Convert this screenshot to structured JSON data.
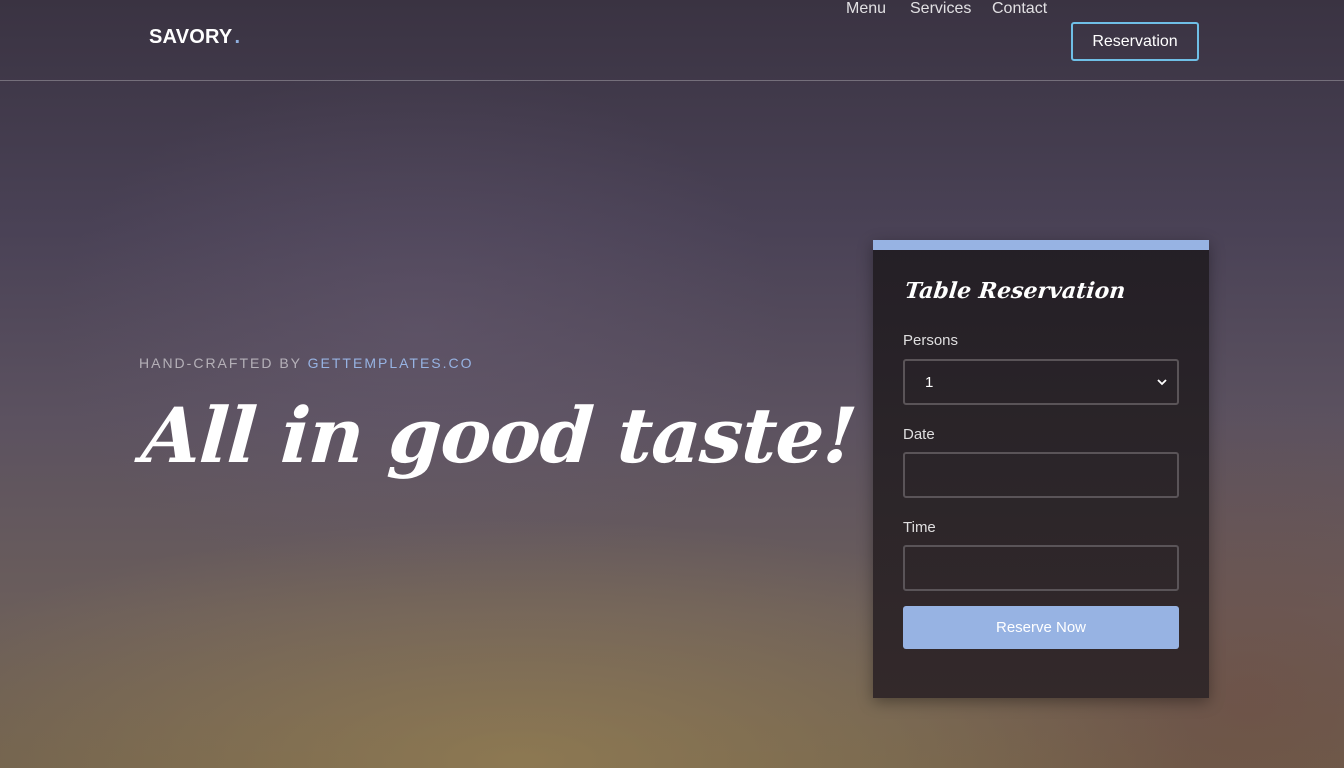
{
  "header": {
    "brand": "SAVORY",
    "brand_dot": ".",
    "nav": {
      "menu": "Menu",
      "services": "Services",
      "contact": "Contact",
      "cta": "Reservation"
    }
  },
  "hero": {
    "eyebrow_prefix": "HAND-CRAFTED BY ",
    "eyebrow_link": "GETTEMPLATES.CO",
    "headline": "All in good taste!"
  },
  "reservation": {
    "title": "Table Reservation",
    "persons_label": "Persons",
    "persons_value": "1",
    "date_label": "Date",
    "date_value": "",
    "time_label": "Time",
    "time_value": "",
    "submit_label": "Reserve Now"
  },
  "colors": {
    "accent": "#97b3e3",
    "cta_border": "#6fbfe6"
  },
  "icons": {
    "select_arrow": "chevron-down-icon"
  }
}
